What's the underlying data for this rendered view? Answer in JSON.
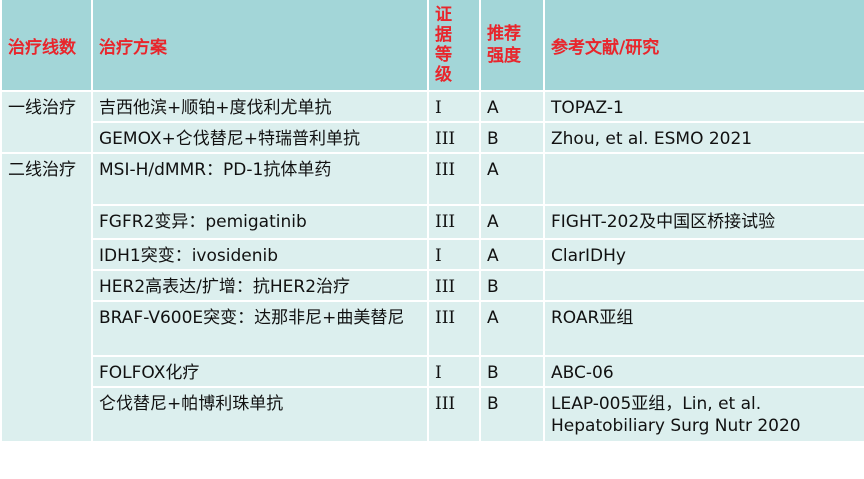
{
  "headers": {
    "line": "治疗线数",
    "regimen": "治疗方案",
    "grade_chars": [
      "证",
      "据",
      "等",
      "级"
    ],
    "strength": "推荐强度",
    "reference": "参考文献/研究"
  },
  "first_line_label": "一线治疗",
  "second_line_label": "二线治疗",
  "rows": [
    {
      "regimen": "吉西他滨+顺铂+度伐利尤单抗",
      "grade": "I",
      "strength": "A",
      "reference": "TOPAZ-1"
    },
    {
      "regimen": "GEMOX+仑伐替尼+特瑞普利单抗",
      "grade": "III",
      "strength": "B",
      "reference": "Zhou, et al. ESMO 2021"
    },
    {
      "regimen": "MSI-H/dMMR：PD-1抗体单药",
      "grade": "III",
      "strength": "A",
      "reference": ""
    },
    {
      "regimen": "FGFR2变异：pemigatinib",
      "grade": "III",
      "strength": "A",
      "reference": "FIGHT-202及中国区桥接试验"
    },
    {
      "regimen": "IDH1突变：ivosidenib",
      "grade": "I",
      "strength": "A",
      "reference": "ClarIDHy"
    },
    {
      "regimen": "HER2高表达/扩增：抗HER2治疗",
      "grade": "III",
      "strength": "B",
      "reference": ""
    },
    {
      "regimen": "BRAF-V600E突变：达那非尼+曲美替尼",
      "grade": "III",
      "strength": "A",
      "reference": "ROAR亚组"
    },
    {
      "regimen": "FOLFOX化疗",
      "grade": "I",
      "strength": "B",
      "reference": "ABC-06"
    },
    {
      "regimen": "仑伐替尼+帕博利珠单抗",
      "grade": "III",
      "strength": "B",
      "reference": "LEAP-005亚组，Lin, et al. Hepatobiliary Surg Nutr 2020"
    }
  ]
}
